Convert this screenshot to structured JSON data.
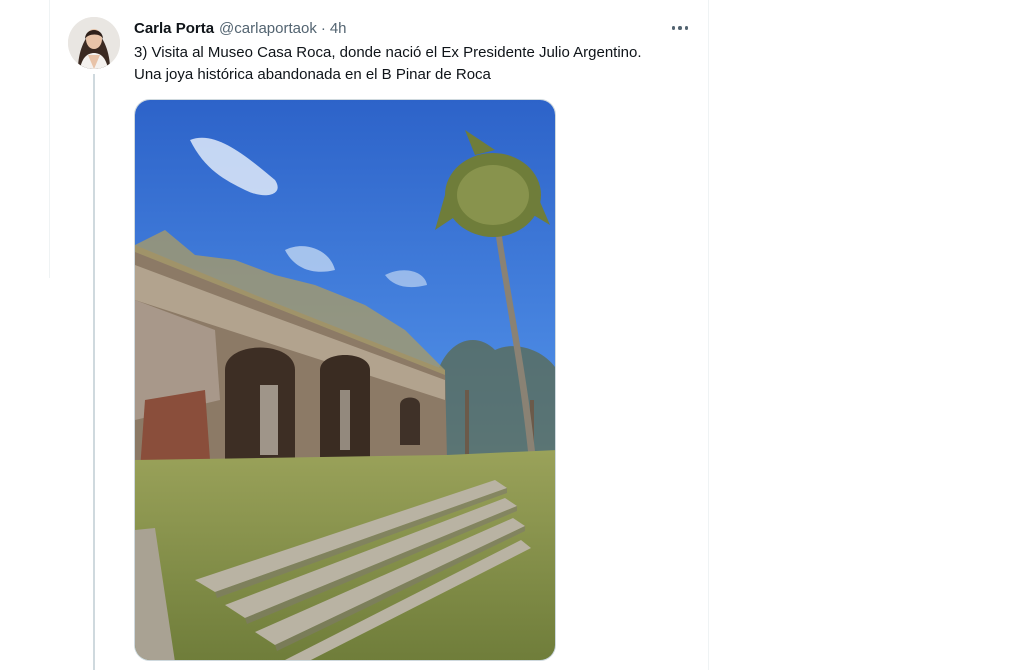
{
  "tweet": {
    "author": {
      "display_name": "Carla Porta",
      "handle": "@carlaportaok"
    },
    "separator": "·",
    "timestamp": "4h",
    "text_lines": [
      "3) Visita al Museo Casa Roca, donde nació el Ex Presidente Julio Argentino.",
      "Una joya histórica abandonada en el B Pinar de Roca"
    ],
    "more_icon": "more-horizontal-icon",
    "media": {
      "kind": "photo",
      "subject": "ruined brick building with arches, palm tree, steps, blue sky"
    }
  },
  "colors": {
    "text_primary": "#0f1419",
    "text_secondary": "#536471",
    "border": "#eff3f4",
    "thread_line": "#cfd9de"
  }
}
